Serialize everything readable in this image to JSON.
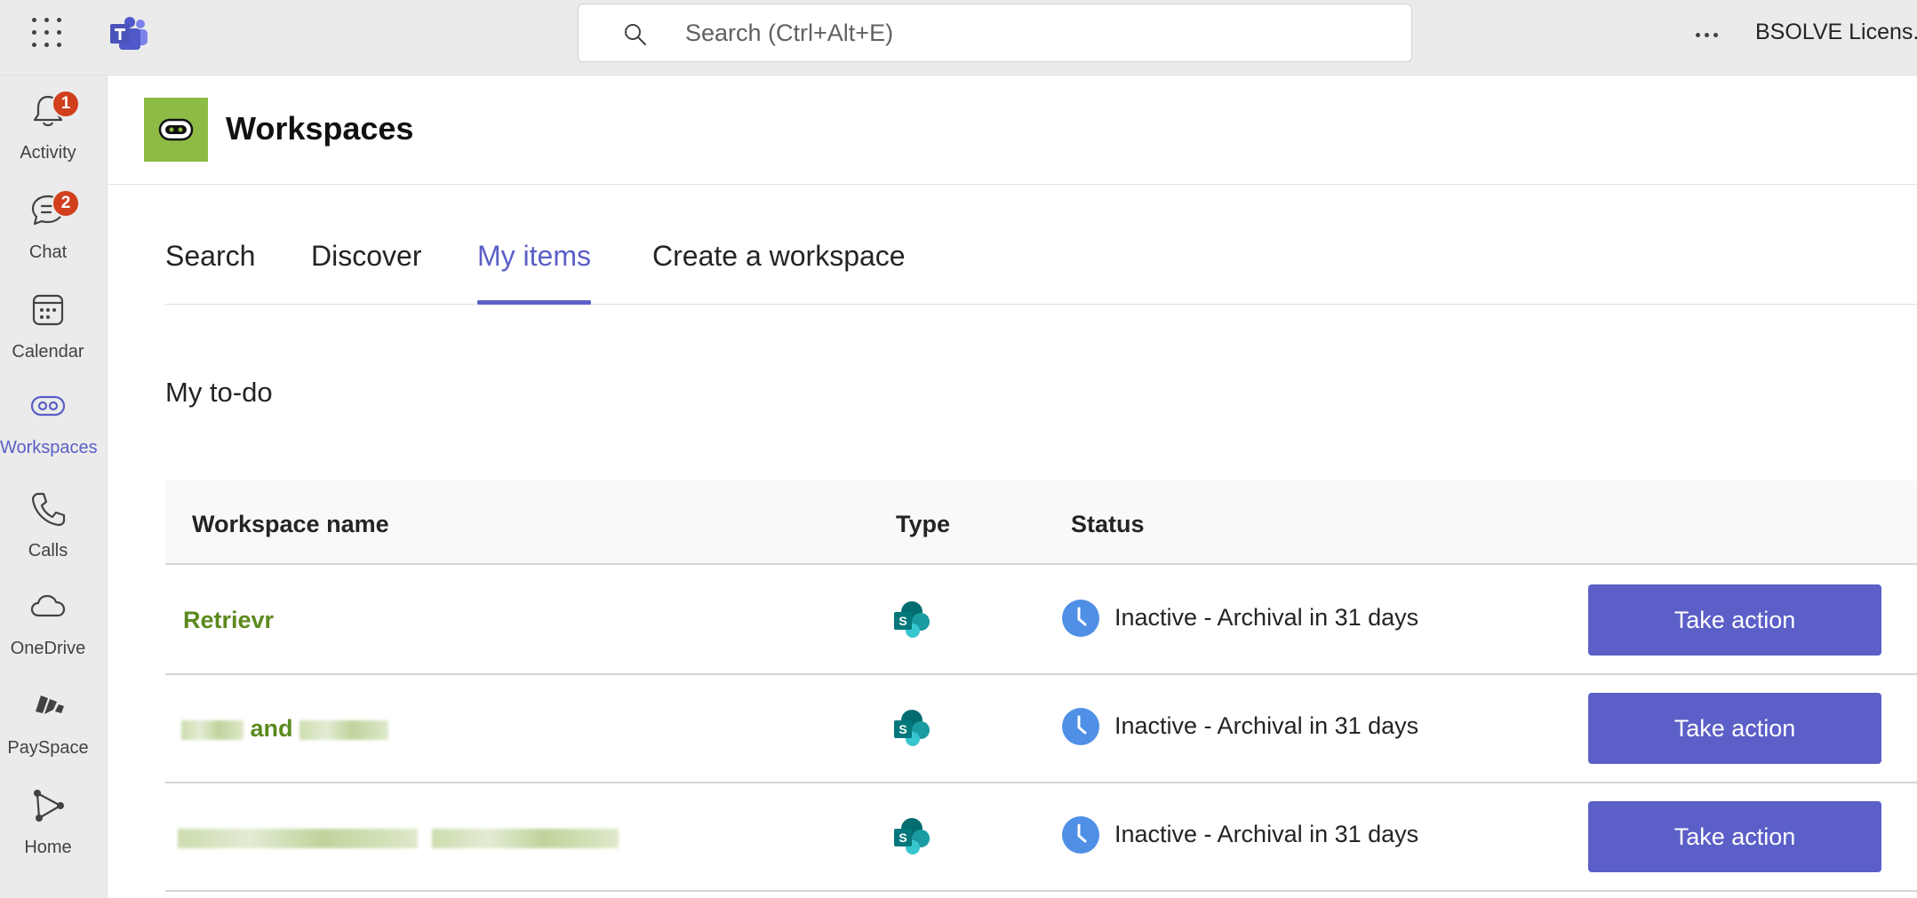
{
  "topbar": {
    "search_placeholder": "Search (Ctrl+Alt+E)",
    "account_name": "BSOLVE Licens..."
  },
  "rail": {
    "items": [
      {
        "label": "Activity",
        "icon": "bell-icon",
        "badge": "1"
      },
      {
        "label": "Chat",
        "icon": "chat-icon",
        "badge": "2"
      },
      {
        "label": "Calendar",
        "icon": "calendar-icon"
      },
      {
        "label": "Workspaces",
        "icon": "workspaces-icon",
        "active": true
      },
      {
        "label": "Calls",
        "icon": "phone-icon"
      },
      {
        "label": "OneDrive",
        "icon": "cloud-icon"
      },
      {
        "label": "PaySpace",
        "icon": "payspace-icon"
      },
      {
        "label": "Home",
        "icon": "home-icon"
      }
    ]
  },
  "app": {
    "title": "Workspaces",
    "logo_color": "#8dbb45"
  },
  "tabs": [
    {
      "label": "Search"
    },
    {
      "label": "Discover"
    },
    {
      "label": "My items",
      "active": true
    },
    {
      "label": "Create a workspace"
    }
  ],
  "section": {
    "title": "My to-do"
  },
  "table": {
    "columns": [
      "Workspace name",
      "Type",
      "Status"
    ],
    "rows": [
      {
        "name": "Retrievr",
        "type_icon": "sharepoint-icon",
        "status": "Inactive - Archival in 31 days",
        "action": "Take action"
      },
      {
        "name_middle": "and",
        "type_icon": "sharepoint-icon",
        "status": "Inactive - Archival in 31 days",
        "action": "Take action"
      },
      {
        "type_icon": "sharepoint-icon",
        "status": "Inactive - Archival in 31 days",
        "action": "Take action"
      }
    ]
  },
  "colors": {
    "accent": "#5b5fc7",
    "link_green": "#5c8a1e",
    "badge": "#d13f1d"
  }
}
